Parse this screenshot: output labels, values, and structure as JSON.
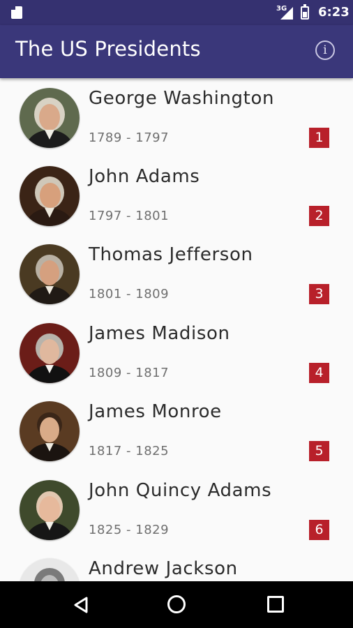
{
  "status_bar": {
    "network_label": "3G",
    "time": "6:23",
    "icons": [
      "sd-card-icon",
      "signal-icon",
      "battery-icon"
    ]
  },
  "app_bar": {
    "title": "The US Presidents",
    "info_icon_glyph": "i",
    "background_color": "#3a377a"
  },
  "presidents": [
    {
      "name": "George Washington",
      "years": "1789 - 1797",
      "number": "1"
    },
    {
      "name": "John Adams",
      "years": "1797 - 1801",
      "number": "2"
    },
    {
      "name": "Thomas Jefferson",
      "years": "1801 - 1809",
      "number": "3"
    },
    {
      "name": "James Madison",
      "years": "1809 - 1817",
      "number": "4"
    },
    {
      "name": "James Monroe",
      "years": "1817 - 1825",
      "number": "5"
    },
    {
      "name": "John Quincy Adams",
      "years": "1825 - 1829",
      "number": "6"
    },
    {
      "name": "Andrew Jackson",
      "years": "",
      "number": ""
    }
  ],
  "colors": {
    "badge": "#b8202a",
    "name_text": "#2b2b2b",
    "years_text": "#6f6f6f"
  },
  "nav_bar": {
    "icons": [
      "back-icon",
      "home-icon",
      "recents-icon"
    ]
  }
}
